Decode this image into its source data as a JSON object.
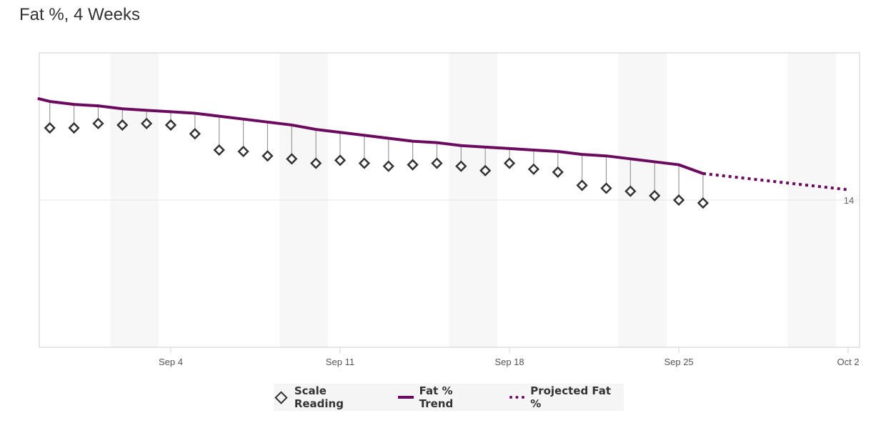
{
  "title": "Fat %, 4 Weeks",
  "chart_data": {
    "type": "line",
    "title": "Fat %, 4 Weeks",
    "xlabel": "",
    "ylabel": "",
    "x_tick_labels": [
      "Sep 4",
      "Sep 11",
      "Sep 18",
      "Sep 25",
      "Oct 2"
    ],
    "y_tick_labels": [
      "14"
    ],
    "ylim": [
      13,
      15
    ],
    "xlim": [
      "Aug 29.5",
      "Oct 2.5"
    ],
    "grid": "horizontal at 14; weekend shading",
    "legend_position": "bottom",
    "colors": {
      "trend": "#6b0a5f",
      "reading": "#333333",
      "stem": "#999999",
      "weekend": "#f7f7f7"
    },
    "series": [
      {
        "name": "Scale Reading",
        "marker": "diamond",
        "x": [
          "Aug 30",
          "Aug 31",
          "Sep 1",
          "Sep 2",
          "Sep 3",
          "Sep 4",
          "Sep 5",
          "Sep 6",
          "Sep 7",
          "Sep 8",
          "Sep 9",
          "Sep 10",
          "Sep 11",
          "Sep 12",
          "Sep 13",
          "Sep 14",
          "Sep 15",
          "Sep 16",
          "Sep 17",
          "Sep 18",
          "Sep 19",
          "Sep 20",
          "Sep 21",
          "Sep 22",
          "Sep 23",
          "Sep 24",
          "Sep 25",
          "Sep 26"
        ],
        "values": [
          14.49,
          14.49,
          14.52,
          14.51,
          14.52,
          14.51,
          14.45,
          14.34,
          14.33,
          14.3,
          14.28,
          14.25,
          14.27,
          14.25,
          14.23,
          14.24,
          14.25,
          14.23,
          14.2,
          14.25,
          14.21,
          14.19,
          14.1,
          14.08,
          14.06,
          14.03,
          14.0,
          13.98
        ]
      },
      {
        "name": "Fat % Trend",
        "style": "solid",
        "x": [
          "Aug 29.5",
          "Aug 30",
          "Aug 31",
          "Sep 1",
          "Sep 2",
          "Sep 3",
          "Sep 4",
          "Sep 5",
          "Sep 6",
          "Sep 7",
          "Sep 8",
          "Sep 9",
          "Sep 10",
          "Sep 11",
          "Sep 12",
          "Sep 13",
          "Sep 14",
          "Sep 15",
          "Sep 16",
          "Sep 17",
          "Sep 18",
          "Sep 19",
          "Sep 20",
          "Sep 21",
          "Sep 22",
          "Sep 23",
          "Sep 24",
          "Sep 25",
          "Sep 26"
        ],
        "values": [
          14.69,
          14.67,
          14.65,
          14.64,
          14.62,
          14.61,
          14.6,
          14.59,
          14.57,
          14.55,
          14.53,
          14.51,
          14.48,
          14.46,
          14.44,
          14.42,
          14.4,
          14.39,
          14.37,
          14.36,
          14.35,
          14.34,
          14.33,
          14.31,
          14.3,
          14.28,
          14.26,
          14.24,
          14.18
        ]
      },
      {
        "name": "Projected Fat %",
        "style": "dotted",
        "x": [
          "Sep 26",
          "Oct 2"
        ],
        "values": [
          14.18,
          14.07
        ]
      }
    ]
  },
  "legend": {
    "items": [
      "Scale Reading",
      "Fat % Trend",
      "Projected Fat %"
    ]
  }
}
